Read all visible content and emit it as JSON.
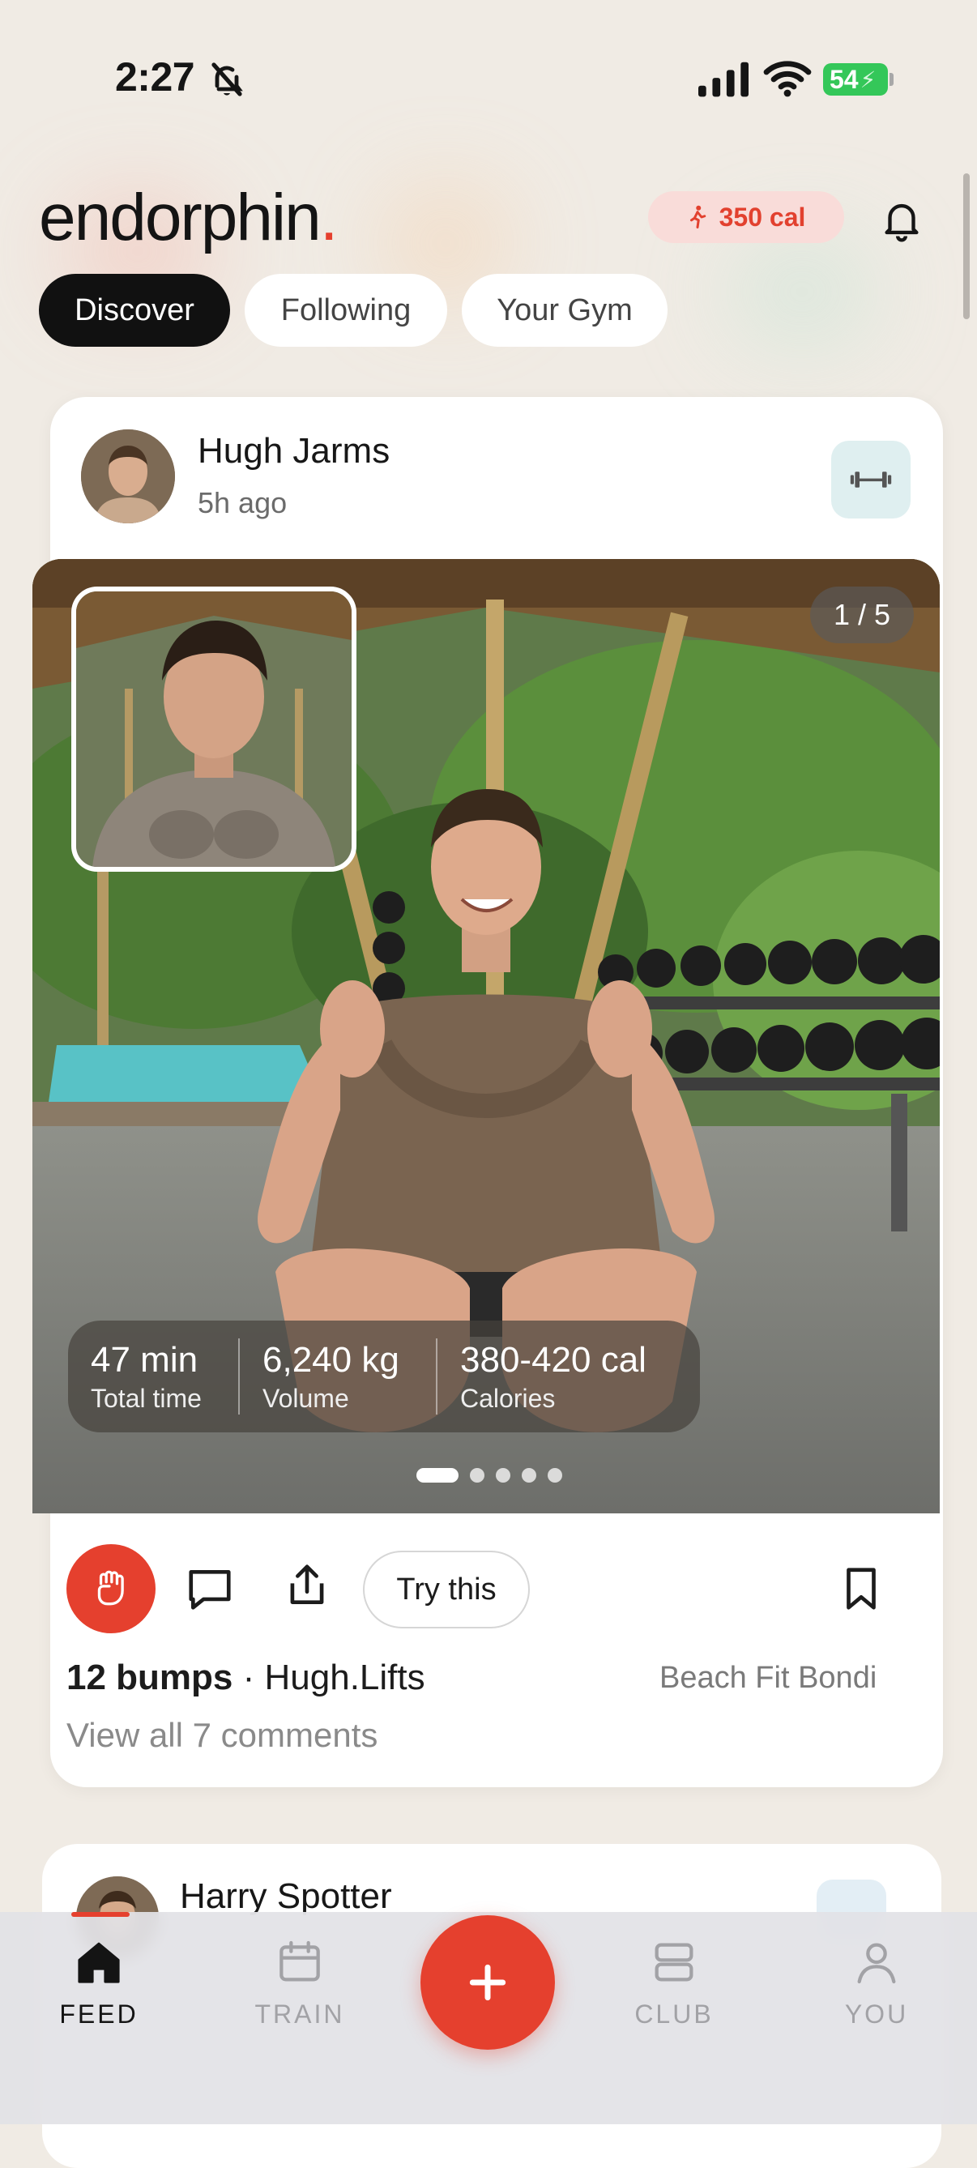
{
  "status_bar": {
    "time": "2:27",
    "battery": "54"
  },
  "header": {
    "logo_text": "endorphin",
    "logo_dot": ".",
    "calories_badge": "350 cal",
    "accent_color": "#e5402e"
  },
  "tabs": [
    {
      "label": "Discover",
      "active": true
    },
    {
      "label": "Following",
      "active": false
    },
    {
      "label": "Your Gym",
      "active": false
    }
  ],
  "post": {
    "author": "Hugh Jarms",
    "time": "5h ago",
    "badge_icon": "dumbbell-icon",
    "photo_counter": "1 / 5",
    "photo_count": 5,
    "current_photo": 1,
    "stats": [
      {
        "value": "47 min",
        "label": "Total time"
      },
      {
        "value": "6,240 kg",
        "label": "Volume"
      },
      {
        "value": "380-420 cal",
        "label": "Calories"
      }
    ],
    "actions": {
      "try_label": "Try this",
      "bump_icon": "fist-icon",
      "comment_icon": "comment-icon",
      "share_icon": "share-icon",
      "bookmark_icon": "bookmark-icon"
    },
    "bumps": "12 bumps",
    "separator": "·",
    "username": "Hugh.Lifts",
    "location": "Beach Fit Bondi",
    "comments_link": "View all 7 comments"
  },
  "next_post": {
    "author": "Harry Spotter"
  },
  "nav": {
    "items": [
      {
        "label": "FEED",
        "icon": "home-icon",
        "active": true
      },
      {
        "label": "TRAIN",
        "icon": "calendar-icon",
        "active": false
      },
      {
        "label": "CLUB",
        "icon": "club-icon",
        "active": false
      },
      {
        "label": "YOU",
        "icon": "person-icon",
        "active": false
      }
    ],
    "fab_icon": "plus-icon"
  }
}
